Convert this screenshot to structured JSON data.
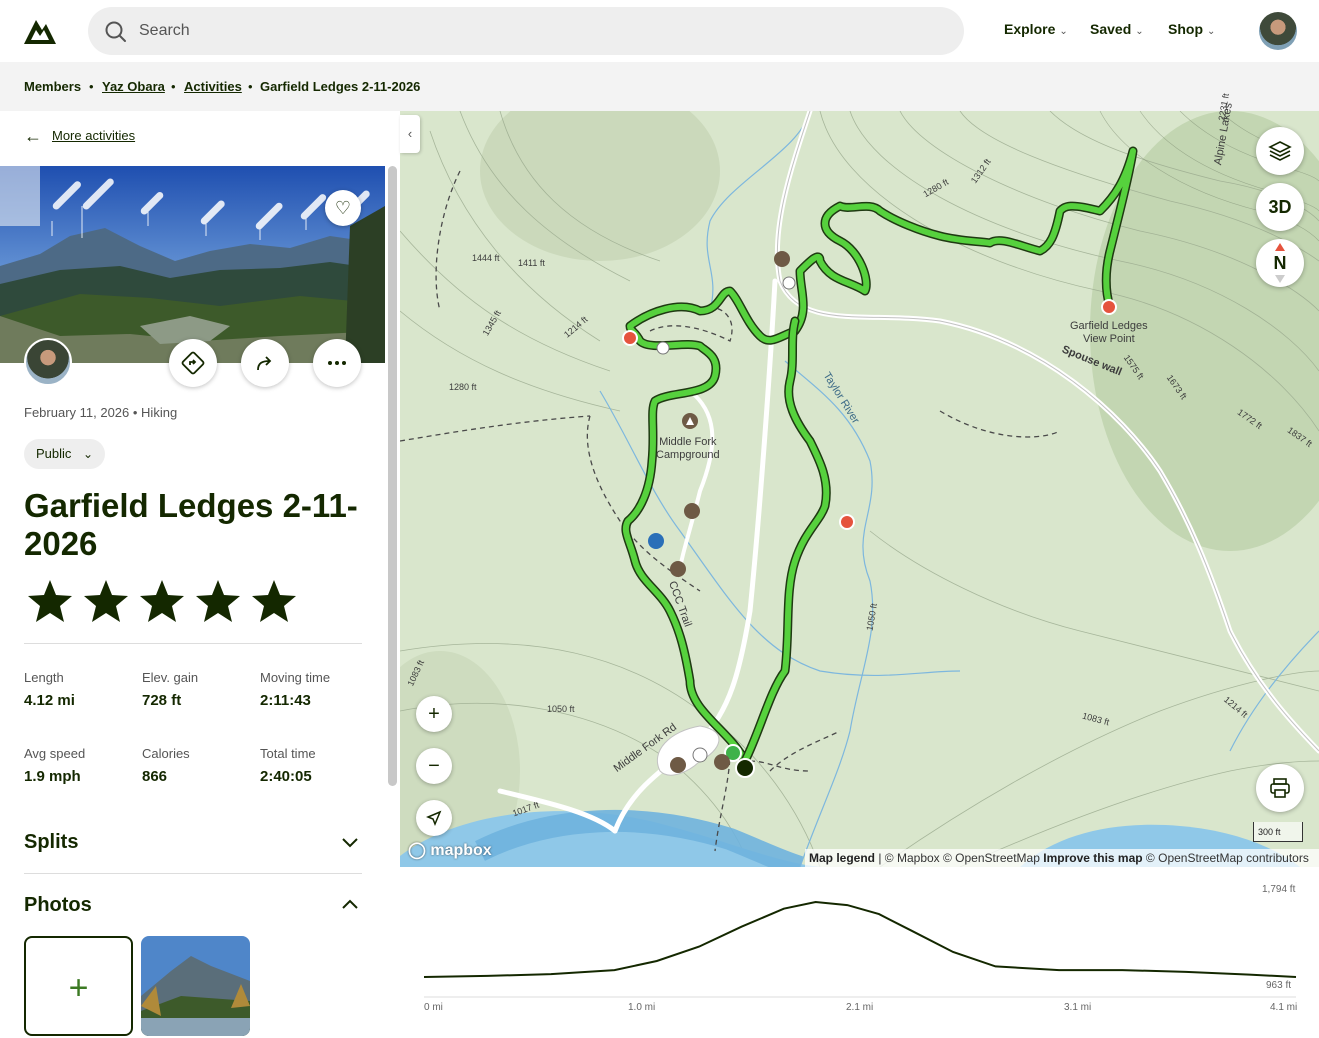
{
  "header": {
    "search_placeholder": "Search",
    "nav": [
      {
        "label": "Explore"
      },
      {
        "label": "Saved"
      },
      {
        "label": "Shop"
      }
    ]
  },
  "breadcrumb": [
    "Members",
    "Yaz Obara",
    "Activities",
    "Garfield Ledges 2-11-2026"
  ],
  "sidebar": {
    "back_label": "More activities",
    "date_type": "February 11, 2026 • Hiking",
    "visibility": "Public",
    "title": "Garfield Ledges 2-11-2026",
    "rating": 5,
    "stats": [
      {
        "label": "Length",
        "value": "4.12 mi"
      },
      {
        "label": "Elev. gain",
        "value": "728 ft"
      },
      {
        "label": "Moving time",
        "value": "2:11:43"
      },
      {
        "label": "Avg speed",
        "value": "1.9 mph"
      },
      {
        "label": "Calories",
        "value": "866"
      },
      {
        "label": "Total time",
        "value": "2:40:05"
      }
    ],
    "sections": [
      {
        "label": "Splits",
        "expanded": false
      },
      {
        "label": "Photos",
        "expanded": true
      }
    ]
  },
  "map": {
    "labels": {
      "viewpoint": "Garfield Ledges\nView Point",
      "viewpoint_l1": "Garfield Ledges",
      "viewpoint_l2": "View Point",
      "campground_l1": "Middle Fork",
      "campground_l2": "Campground",
      "river": "Taylor River",
      "road": "Middle Fork Rd",
      "spouse": "Spouse wall",
      "trail": "CCC Trail",
      "alpine": "Alpine Lakes"
    },
    "contours": [
      "1444 ft",
      "1411 ft",
      "1214 ft",
      "1345 ft",
      "1280 ft",
      "1312 ft",
      "1280 ft",
      "1575 ft",
      "1673 ft",
      "1772 ft",
      "1837 ft",
      "2231 ft",
      "1050 ft",
      "1050 ft",
      "1083 ft",
      "1083 ft",
      "1214 ft",
      "1017 ft"
    ],
    "buttons": {
      "threed": "3D",
      "north": "N"
    },
    "scale": "300 ft",
    "logo": "mapbox",
    "attribution": {
      "legend": "Map legend",
      "sources": " | © Mapbox © OpenStreetMap ",
      "improve": "Improve this map",
      "contrib": " © OpenStreetMap contributors"
    },
    "accent_track": "#4cc13b",
    "marker_color": "#e5533d"
  },
  "elevation": {
    "max_label": "1,794 ft",
    "min_label": "963 ft",
    "x_labels": [
      "0 mi",
      "1.0 mi",
      "2.1 mi",
      "3.1 mi",
      "4.1 mi"
    ]
  },
  "chart_data": {
    "type": "area",
    "x": [
      0,
      0.3,
      0.6,
      0.9,
      1.1,
      1.3,
      1.5,
      1.7,
      1.85,
      2.0,
      2.15,
      2.3,
      2.5,
      2.7,
      3.0,
      3.3,
      3.6,
      3.9,
      4.12
    ],
    "y": [
      963,
      975,
      995,
      1040,
      1140,
      1300,
      1520,
      1720,
      1794,
      1760,
      1660,
      1480,
      1240,
      1080,
      1040,
      1040,
      1020,
      990,
      963
    ],
    "xlabel": "",
    "ylabel": "",
    "ylim": [
      963,
      1794
    ]
  }
}
